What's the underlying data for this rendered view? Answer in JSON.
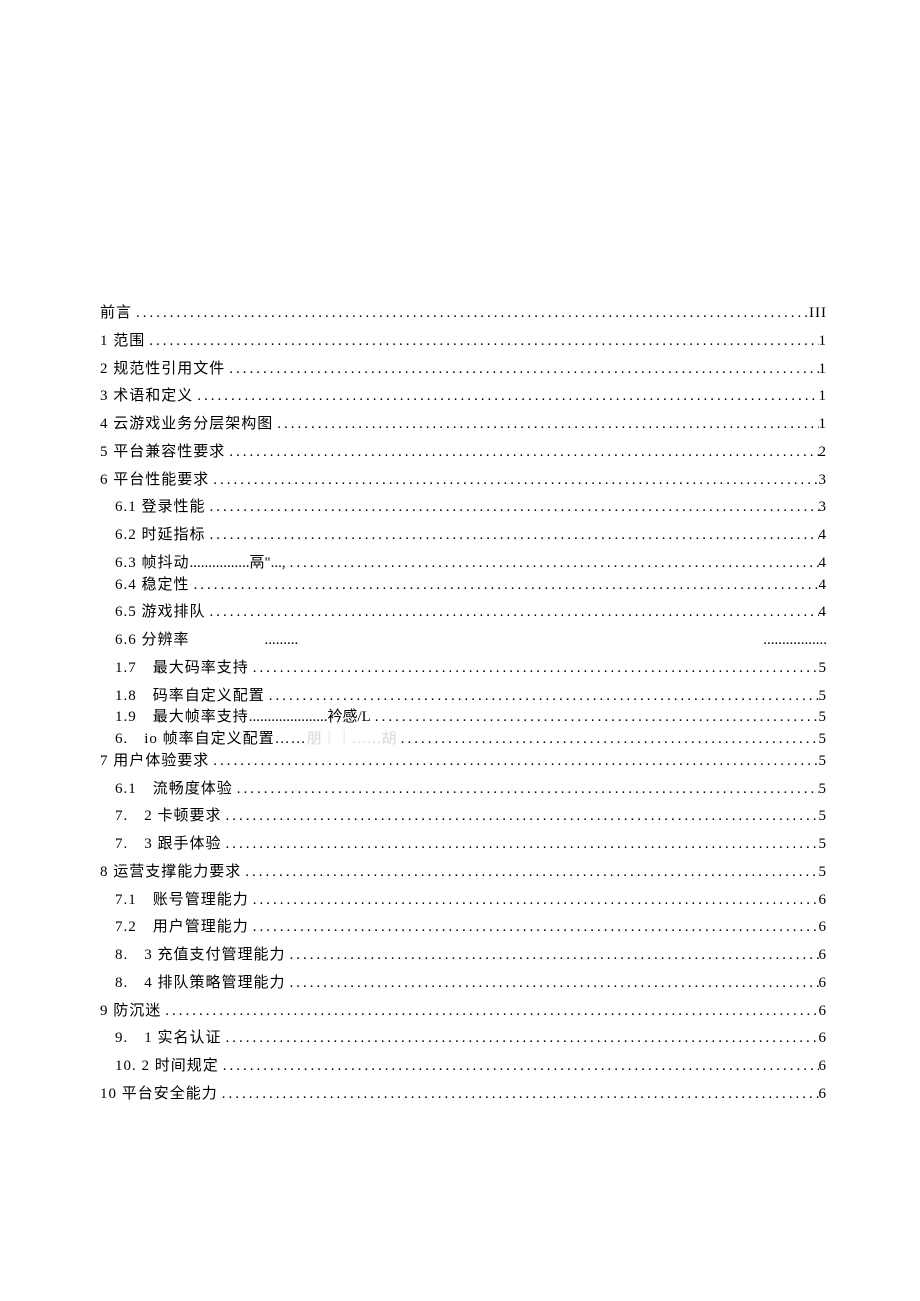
{
  "toc": [
    {
      "lvl": 0,
      "label": "前言",
      "mid": "",
      "page": "III"
    },
    {
      "lvl": 0,
      "label": "1 范围",
      "mid": "",
      "page": "1"
    },
    {
      "lvl": 0,
      "label": "2 规范性引用文件",
      "mid": "",
      "page": "1"
    },
    {
      "lvl": 0,
      "label": "3 术语和定义",
      "mid": "",
      "page": "1"
    },
    {
      "lvl": 0,
      "label": "4 云游戏业务分层架构图",
      "mid": "",
      "page": "1"
    },
    {
      "lvl": 0,
      "label": "5 平台兼容性要求",
      "mid": "",
      "page": "2"
    },
    {
      "lvl": 0,
      "label": "6 平台性能要求",
      "mid": "",
      "page": "3"
    },
    {
      "lvl": 1,
      "label": "6.1 登录性能",
      "mid": "",
      "page": "3"
    },
    {
      "lvl": 1,
      "label": "6.2 时延指标",
      "mid": "",
      "page": "4"
    },
    {
      "lvl": 1,
      "label": "6.3 帧抖动",
      "mid": "鬲\"",
      "page": "4"
    },
    {
      "lvl": 1,
      "label": "6.4 稳定性",
      "mid": "",
      "page": "4",
      "tight": true
    },
    {
      "lvl": 1,
      "label": "6.5 游戏排队",
      "mid": "",
      "page": "4"
    },
    {
      "lvl": 1,
      "label": "6.6 分辨率",
      "mid": "",
      "page": "",
      "gapped": true
    },
    {
      "lvl": 1,
      "label": "1.7　最大码率支持",
      "mid": "",
      "page": "5"
    },
    {
      "lvl": 1,
      "label": "1.8　码率自定义配置",
      "mid": "",
      "page": "5"
    },
    {
      "lvl": 1,
      "label": "1.9　最大帧率支持",
      "mid": "衿感/L",
      "page": "5",
      "tight": true
    },
    {
      "lvl": 1,
      "label": "6.　io 帧率自定义配置……",
      "mid": "",
      "page": "5",
      "tight": true,
      "ghost": "朋｜｜……胡"
    },
    {
      "lvl": 0,
      "label": "7 用户体验要求",
      "mid": "",
      "page": "5",
      "tight": true
    },
    {
      "lvl": 1,
      "label": "6.1　流畅度体验",
      "mid": "",
      "page": "5"
    },
    {
      "lvl": 1,
      "label": "7.　2 卡顿要求",
      "mid": "",
      "page": "5"
    },
    {
      "lvl": 1,
      "label": "7.　3 跟手体验",
      "mid": "",
      "page": "5"
    },
    {
      "lvl": 0,
      "label": "8 运营支撑能力要求",
      "mid": "",
      "page": "5"
    },
    {
      "lvl": 1,
      "label": "7.1　账号管理能力",
      "mid": "",
      "page": "6"
    },
    {
      "lvl": 1,
      "label": "7.2　用户管理能力",
      "mid": "",
      "page": "6"
    },
    {
      "lvl": 1,
      "label": "8.　3 充值支付管理能力",
      "mid": "",
      "page": "6"
    },
    {
      "lvl": 1,
      "label": "8.　4 排队策略管理能力",
      "mid": "",
      "page": "6"
    },
    {
      "lvl": 0,
      "label": "9 防沉迷",
      "mid": "",
      "page": "6"
    },
    {
      "lvl": 1,
      "label": "9.　1 实名认证",
      "mid": "",
      "page": "6"
    },
    {
      "lvl": 1,
      "label": "10. 2 时间规定",
      "mid": "",
      "page": "6"
    },
    {
      "lvl": 0,
      "label": "10 平台安全能力",
      "mid": "",
      "page": "6"
    }
  ],
  "dotstr": "...............................................................................................................................................",
  "gapdots": "........."
}
